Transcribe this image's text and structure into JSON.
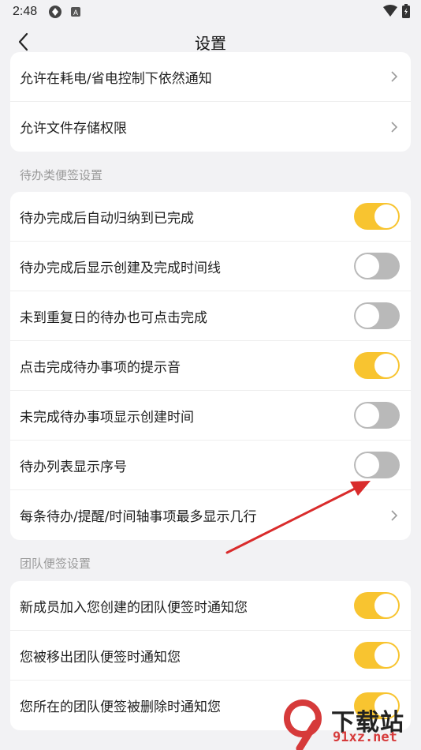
{
  "status_bar": {
    "time": "2:48"
  },
  "header": {
    "title": "设置"
  },
  "card_top": {
    "items": [
      {
        "label": "允许在耗电/省电控制下依然通知"
      },
      {
        "label": "允许文件存储权限"
      }
    ]
  },
  "section_todo": {
    "title": "待办类便签设置",
    "items": [
      {
        "label": "待办完成后自动归纳到已完成",
        "toggle": "on"
      },
      {
        "label": "待办完成后显示创建及完成时间线",
        "toggle": "off"
      },
      {
        "label": "未到重复日的待办也可点击完成",
        "toggle": "off"
      },
      {
        "label": "点击完成待办事项的提示音",
        "toggle": "on"
      },
      {
        "label": "未完成待办事项显示创建时间",
        "toggle": "off"
      },
      {
        "label": "待办列表显示序号",
        "toggle": "off"
      },
      {
        "label": "每条待办/提醒/时间轴事项最多显示几行"
      }
    ]
  },
  "section_team": {
    "title": "团队便签设置",
    "items": [
      {
        "label": "新成员加入您创建的团队便签时通知您",
        "toggle": "on"
      },
      {
        "label": "您被移出团队便签时通知您",
        "toggle": "on"
      },
      {
        "label": "您所在的团队便签被删除时通知您",
        "toggle": "on"
      }
    ]
  },
  "watermark": {
    "line1": "下载站",
    "line2": "91xz.net"
  },
  "colors": {
    "toggle_on": "#f8c430",
    "toggle_off": "#b9b9b9",
    "arrow": "#d92b2b"
  }
}
